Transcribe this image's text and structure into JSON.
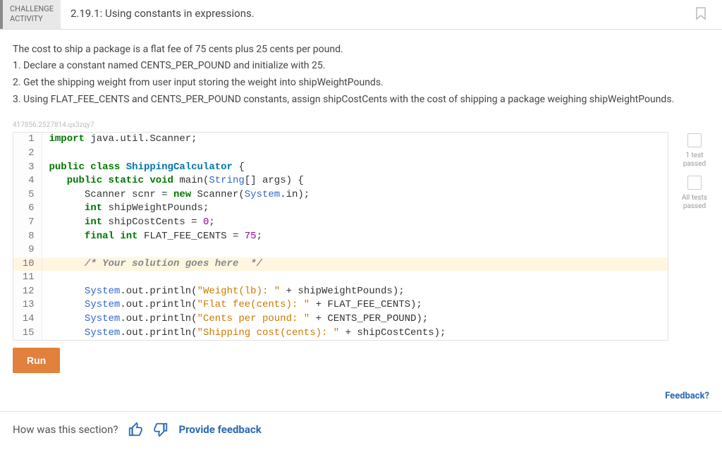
{
  "header": {
    "tag_label": "CHALLENGE\nACTIVITY",
    "title": "2.19.1: Using constants in expressions."
  },
  "problem": {
    "intro": "The cost to ship a package is a flat fee of 75 cents plus 25 cents per pound.",
    "step1": "1. Declare a constant named CENTS_PER_POUND and initialize with 25.",
    "step2": "2. Get the shipping weight from user input storing the weight into shipWeightPounds.",
    "step3": "3. Using FLAT_FEE_CENTS and CENTS_PER_POUND constants, assign shipCostCents with the cost of shipping a package weighing shipWeightPounds."
  },
  "hash": "417856.2527814.qx3zqy7",
  "code": {
    "lines": [
      {
        "n": "1",
        "html": "<span class='kw'>import</span> java.util.Scanner;"
      },
      {
        "n": "2",
        "html": ""
      },
      {
        "n": "3",
        "html": "<span class='kw'>public class</span> <span class='cls'>ShippingCalculator</span> {"
      },
      {
        "n": "4",
        "html": "   <span class='kw'>public static</span> <span class='kw'>void</span> main(<span class='typ'>String</span>[] args) {"
      },
      {
        "n": "5",
        "html": "      Scanner scnr = <span class='kw'>new</span> Scanner(<span class='typ'>System</span>.in);"
      },
      {
        "n": "6",
        "html": "      <span class='kw'>int</span> shipWeightPounds;"
      },
      {
        "n": "7",
        "html": "      <span class='kw'>int</span> shipCostCents = <span class='num'>0</span>;"
      },
      {
        "n": "8",
        "html": "      <span class='kw'>final int</span> FLAT_FEE_CENTS = <span class='num'>75</span>;"
      },
      {
        "n": "9",
        "html": ""
      },
      {
        "n": "10",
        "html": "      <span class='cmt'>/* Your solution goes here  */</span>",
        "hl": true
      },
      {
        "n": "11",
        "html": ""
      },
      {
        "n": "12",
        "html": "      <span class='typ'>System</span>.out.println(<span class='str'>\"Weight(lb): \"</span> + shipWeightPounds);"
      },
      {
        "n": "13",
        "html": "      <span class='typ'>System</span>.out.println(<span class='str'>\"Flat fee(cents): \"</span> + FLAT_FEE_CENTS);"
      },
      {
        "n": "14",
        "html": "      <span class='typ'>System</span>.out.println(<span class='str'>\"Cents per pound: \"</span> + CENTS_PER_POUND);"
      },
      {
        "n": "15",
        "html": "      <span class='typ'>System</span>.out.println(<span class='str'>\"Shipping cost(cents): \"</span> + shipCostCents);"
      }
    ]
  },
  "status": {
    "box1_label": "1 test\npassed",
    "box2_label": "All tests\npassed"
  },
  "run_label": "Run",
  "feedback_label": "Feedback?",
  "footer": {
    "question": "How was this section?",
    "provide_label": "Provide feedback"
  }
}
